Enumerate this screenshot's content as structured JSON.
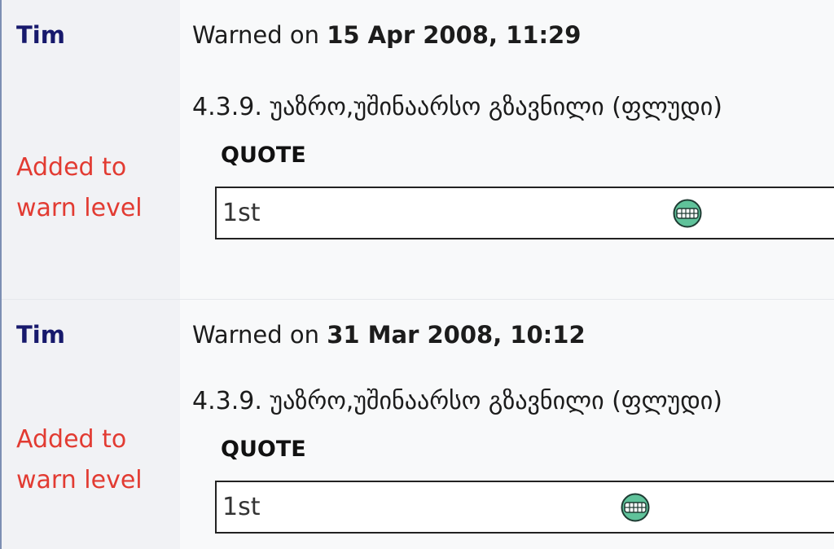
{
  "warnings": [
    {
      "user": "Tim",
      "warned_prefix": "Warned on ",
      "date": "15 Apr 2008, 11:29",
      "action": "Added to warn level",
      "rule": "4.3.9. უაზრო,უშინაარსო გზავნილი (ფლუდი)",
      "quote_label": "QUOTE",
      "quote_text": "1st",
      "emoticon": "grin-icon"
    },
    {
      "user": "Tim",
      "warned_prefix": "Warned on ",
      "date": "31 Mar 2008, 10:12",
      "action": "Added to warn level",
      "rule": "4.3.9. უაზრო,უშინაარსო გზავნილი (ფლუდი)",
      "quote_label": "QUOTE",
      "quote_text": "1st",
      "emoticon": "grin-icon"
    }
  ],
  "colors": {
    "user": "#17196c",
    "action": "#e23b32",
    "border": "#7d8fb3"
  }
}
